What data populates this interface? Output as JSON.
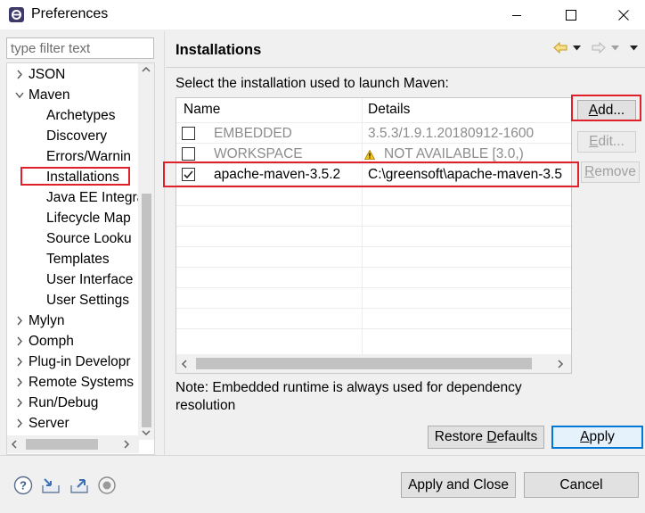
{
  "window": {
    "title": "Preferences",
    "icon": "eclipse-app-icon",
    "controls": [
      "minimize-icon",
      "maximize-icon",
      "close-icon"
    ]
  },
  "filter": {
    "placeholder": "type filter text",
    "value": ""
  },
  "tree": {
    "items": [
      {
        "label": "JSON",
        "level": 0,
        "expanded": false
      },
      {
        "label": "Maven",
        "level": 0,
        "expanded": true
      },
      {
        "label": "Archetypes",
        "level": 1
      },
      {
        "label": "Discovery",
        "level": 1
      },
      {
        "label": "Errors/Warnin",
        "level": 1
      },
      {
        "label": "Installations",
        "level": 1,
        "selected": true
      },
      {
        "label": "Java EE Integra",
        "level": 1
      },
      {
        "label": "Lifecycle Map",
        "level": 1
      },
      {
        "label": "Source Looku",
        "level": 1
      },
      {
        "label": "Templates",
        "level": 1
      },
      {
        "label": "User Interface",
        "level": 1
      },
      {
        "label": "User Settings",
        "level": 1
      },
      {
        "label": "Mylyn",
        "level": 0,
        "expanded": false
      },
      {
        "label": "Oomph",
        "level": 0,
        "expanded": false
      },
      {
        "label": "Plug-in Developr",
        "level": 0,
        "expanded": false
      },
      {
        "label": "Remote Systems",
        "level": 0,
        "expanded": false
      },
      {
        "label": "Run/Debug",
        "level": 0,
        "expanded": false
      },
      {
        "label": "Server",
        "level": 0,
        "expanded": false
      }
    ]
  },
  "page": {
    "title": "Installations",
    "description": "Select the installation used to launch Maven:",
    "nav_icons": [
      "back-arrow-icon",
      "dropdown-icon",
      "forward-arrow-icon",
      "dropdown-icon",
      "view-menu-icon"
    ]
  },
  "table": {
    "columns": [
      "Name",
      "Details"
    ],
    "rows": [
      {
        "checked": false,
        "name": "EMBEDDED",
        "details": "3.5.3/1.9.1.20180912-1600",
        "enabled": false,
        "warning": false
      },
      {
        "checked": false,
        "name": "WORKSPACE",
        "details": "NOT AVAILABLE [3.0,)",
        "enabled": false,
        "warning": true
      },
      {
        "checked": true,
        "name": "apache-maven-3.5.2",
        "details": "C:\\greensoft\\apache-maven-3.5",
        "enabled": true,
        "warning": false
      }
    ]
  },
  "buttons": {
    "add": {
      "pre": "",
      "mn": "A",
      "post": "dd..."
    },
    "edit": {
      "pre": "",
      "mn": "E",
      "post": "dit..."
    },
    "remove": {
      "pre": "",
      "mn": "R",
      "post": "emove"
    },
    "restore": {
      "pre": "Restore ",
      "mn": "D",
      "post": "efaults"
    },
    "apply": {
      "pre": "",
      "mn": "A",
      "post": "pply"
    },
    "apply_close": "Apply and Close",
    "cancel": "Cancel"
  },
  "note": "Note: Embedded runtime is always used for dependency resolution",
  "footer_icons": [
    "help-icon",
    "import-icon",
    "export-icon",
    "record-icon"
  ],
  "colors": {
    "highlight_red": "#e0212b",
    "default_button_blue": "#0078d7",
    "warning_yellow": "#f5c518"
  }
}
